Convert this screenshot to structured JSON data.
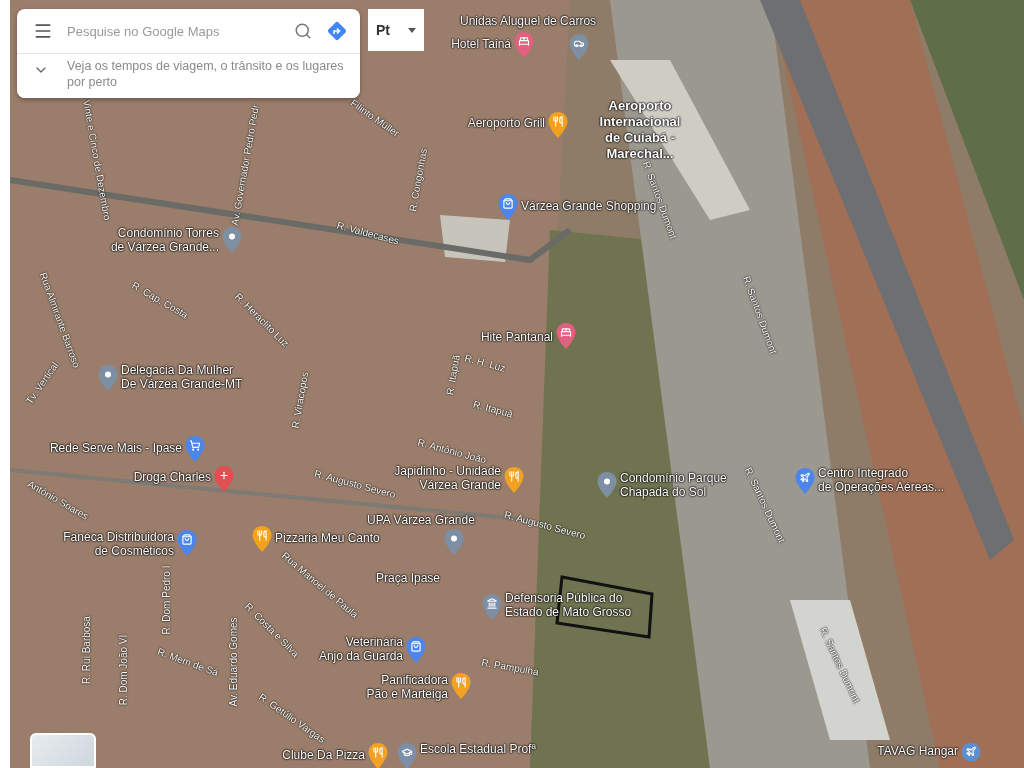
{
  "search_panel": {
    "placeholder": "Pesquise no Google Maps",
    "hint": "Veja os tempos de viagem, o trânsito e os lugares por perto"
  },
  "language_chip": {
    "label": "Pt"
  },
  "places": [
    {
      "kind": "car",
      "color": "#7d8fa0",
      "lines": [
        "Unidas Aluguel de Carros"
      ]
    },
    {
      "kind": "hotel",
      "color": "#e0607e",
      "lines": [
        "Hotel Tainá"
      ]
    },
    {
      "kind": "restaurant",
      "color": "#f2a11f",
      "lines": [
        "Aeroporto Grill"
      ]
    },
    {
      "kind": "area",
      "lines": [
        "Aeroporto",
        "Internacional",
        "de Cuiabá -",
        "Marechal..."
      ]
    },
    {
      "kind": "shopping",
      "color": "#4c86e8",
      "lines": [
        "Várzea Grande Shopping"
      ]
    },
    {
      "kind": "place",
      "color": "#7d8fa1",
      "lines": [
        "Condomínio Torres",
        "de Várzea Grande..."
      ]
    },
    {
      "kind": "hotel",
      "color": "#e0607f",
      "lines": [
        "Hite Pantanal"
      ]
    },
    {
      "kind": "place",
      "color": "#7d8fa2",
      "lines": [
        "Delegacia Da Mulher",
        "De Várzea Grande-MT"
      ]
    },
    {
      "kind": "cart",
      "color": "#4c86e9",
      "lines": [
        "Rede Serve Mais - Ipase"
      ]
    },
    {
      "kind": "pharmacy",
      "color": "#e05050",
      "lines": [
        "Droga Charles"
      ]
    },
    {
      "kind": "restaurant",
      "color": "#f2a120",
      "lines": [
        "Japidinho - Unidade",
        "Várzea Grande"
      ]
    },
    {
      "kind": "place",
      "color": "#7d8fa3",
      "lines": [
        "Condomínio Parque",
        "Chapada do Sol"
      ]
    },
    {
      "kind": "place",
      "color": "#7d8fa4",
      "lines": [
        "UPA Várzea Grande"
      ]
    },
    {
      "kind": "airport",
      "color": "#4c86ea",
      "lines": [
        "Centro Integrado",
        "de Operações Aéreas..."
      ]
    },
    {
      "kind": "shopping",
      "color": "#4c86eb",
      "lines": [
        "Fanéca Distribuidora",
        "de Cosméticos"
      ]
    },
    {
      "kind": "restaurant",
      "color": "#f2a121",
      "lines": [
        "Pizzaria Meu Canto"
      ]
    },
    {
      "kind": "area",
      "lines": [
        "Praça Ipase"
      ]
    },
    {
      "kind": "government",
      "color": "#7d8fa5",
      "lines": [
        "Defensoria Pública do",
        "Estado de Mato Grosso"
      ]
    },
    {
      "kind": "shopping",
      "color": "#4c86ec",
      "lines": [
        "Veterinária",
        "Anjo da Guarda"
      ]
    },
    {
      "kind": "restaurant",
      "color": "#f2a122",
      "lines": [
        "Panificadora",
        "Pão e Marteiga"
      ]
    },
    {
      "kind": "restaurant",
      "color": "#f2a123",
      "lines": [
        "Clube Da Pizza"
      ]
    },
    {
      "kind": "school",
      "color": "#7d8fa6",
      "lines": [
        "Escola Estadual Profª"
      ]
    },
    {
      "kind": "airport_circle",
      "color": "#5b8fcf",
      "lines": [
        "TAVAG Hangar"
      ]
    }
  ],
  "streets": [
    "Filinto Müller",
    "Av. Governador Pedro Pedr",
    "Vinte e Cinco de Dezembro",
    "R. Congonhas",
    "R. Valdecases",
    "Rua Almirante Barroso",
    "R. Cap. Costa",
    "R. Heráclito Luz",
    "Tv. Vertical",
    "R. Viracopos",
    "R. Itapuã",
    "R. H. Luz",
    "R. Itapuã",
    "R. Antônio João",
    "R. Augusto Severo",
    "Antônio Soares",
    "R. Augusto Severo",
    "Rua Manoel de Paula",
    "R. Dom Pedro I",
    "R. Rui Barbosa",
    "R. Dom João VI",
    "R. Mem de Sá",
    "Av. Eduardo Gomes",
    "R. Costa e Silva",
    "R. Getúlio Vargas",
    "R. Pampulha",
    "R. Santos Dumont",
    "R. Santos Dumont",
    "R. Santos Dumont",
    "R. Santos Dumont"
  ]
}
